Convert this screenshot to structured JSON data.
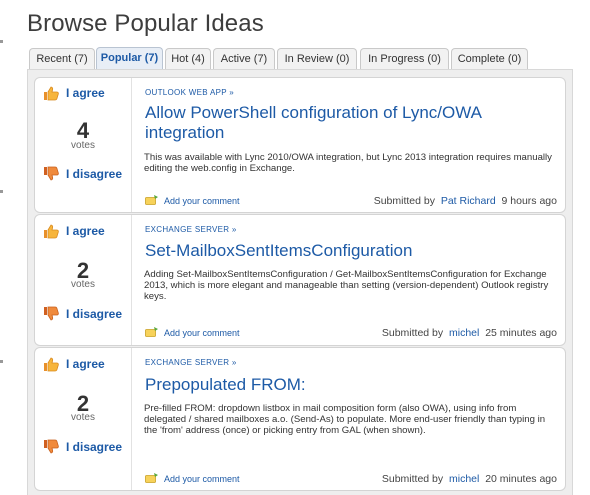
{
  "page": {
    "title": "Browse Popular Ideas"
  },
  "tabs": [
    {
      "label": "Recent (7)"
    },
    {
      "label": "Popular (7)"
    },
    {
      "label": "Hot (4)"
    },
    {
      "label": "Active (7)"
    },
    {
      "label": "In Review (0)"
    },
    {
      "label": "In Progress (0)"
    },
    {
      "label": "Complete (0)"
    }
  ],
  "active_tab": "Popular (7)",
  "vote_labels": {
    "agree": "I agree",
    "disagree": "I disagree",
    "votes": "votes"
  },
  "comment_label": "Add your comment",
  "submitted_prefix": "Submitted by",
  "ideas": [
    {
      "category": "OUTLOOK WEB APP »",
      "title": "Allow PowerShell configuration of Lync/OWA integration",
      "votes": "4",
      "description": "This was available with Lync 2010/OWA integration, but Lync 2013 integration requires manually editing the web.config in Exchange.",
      "author": "Pat Richard",
      "time": "9 hours ago"
    },
    {
      "category": "EXCHANGE SERVER »",
      "title": "Set-MailboxSentItemsConfiguration",
      "votes": "2",
      "description": "Adding Set-MailboxSentItemsConfiguration / Get-MailboxSentItemsConfiguration for Exchange 2013, which is more elegant and manageable than setting (version-dependent) Outlook registry keys.",
      "author": "michel",
      "time": "25 minutes ago"
    },
    {
      "category": "EXCHANGE SERVER »",
      "title": "Prepopulated FROM:",
      "votes": "2",
      "description": "Pre-filled FROM: dropdown listbox in mail composition form (also OWA), using info from delegated / shared mailboxes a.o. (Send-As) to populate. More end-user friendly than typing in the 'from' address (once) or picking entry from GAL (when shown).",
      "author": "michel",
      "time": "20 minutes ago"
    }
  ],
  "colors": {
    "link": "#1d5aa6",
    "panel_bg": "#eeeeee",
    "thumb_up": "#f0a030",
    "thumb_down": "#e06a2a"
  }
}
